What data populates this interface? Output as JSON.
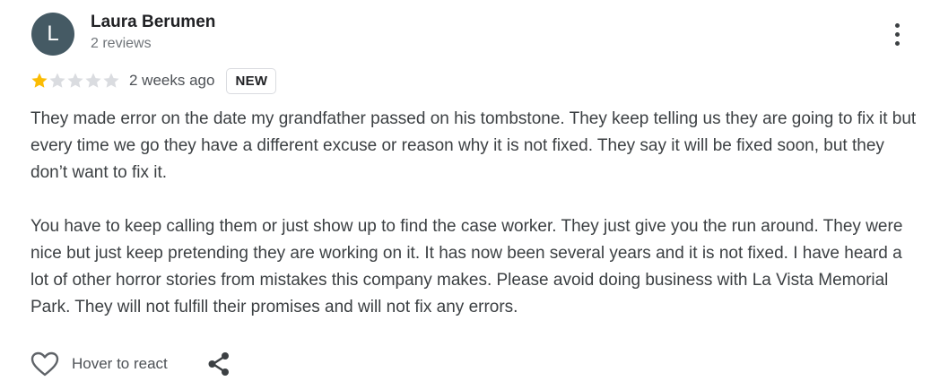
{
  "review": {
    "author": {
      "initial": "L",
      "name": "Laura Berumen",
      "meta": "2 reviews",
      "avatar_color": "#455a64"
    },
    "rating": {
      "value": 1,
      "max": 5,
      "filled_color": "#fbbc04",
      "empty_color": "#dadce0"
    },
    "time": "2 weeks ago",
    "badge": "NEW",
    "paragraphs": [
      "They made error on the date my grandfather passed on his tombstone. They keep telling us they are going to fix it but every time we go they have a different excuse or reason why it is not fixed. They say it will be fixed soon, but they don’t want to fix it.",
      "You have to keep calling them or just show up to find the case worker. They just give you the run around. They were nice but just keep pretending they are working on it. It has now been several years and it is not fixed. I have heard a lot of other horror stories from mistakes this company makes. Please avoid doing business with La Vista Memorial Park. They will not fulfill their promises and will not fix any errors."
    ],
    "actions": {
      "react_label": "Hover to react",
      "react_icon": "heart-outline-icon",
      "share_icon": "share-icon",
      "more_icon": "more-vert-icon"
    }
  }
}
